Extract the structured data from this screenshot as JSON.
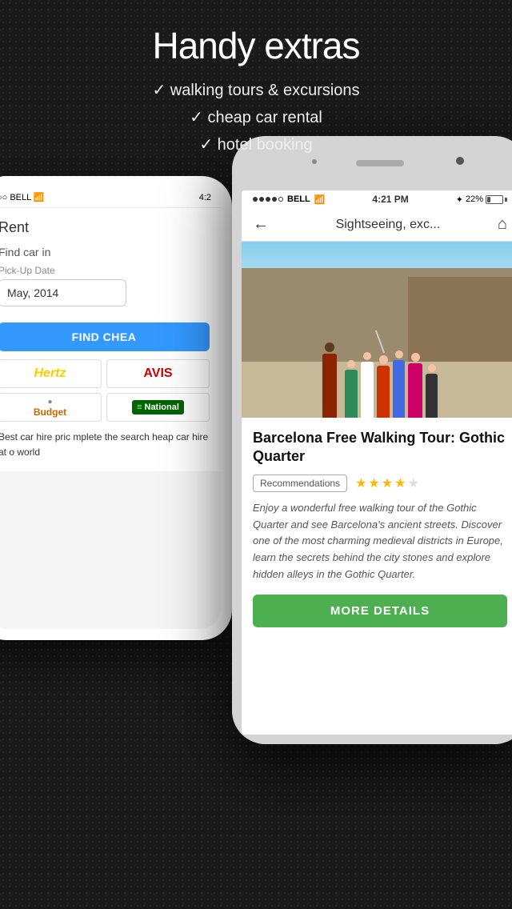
{
  "page": {
    "background_color": "#1a1a1a"
  },
  "header": {
    "title": "Handy extras",
    "features": [
      "✓ walking tours & excursions",
      "✓ cheap car rental",
      "✓ hotel booking"
    ]
  },
  "phone_back": {
    "status": {
      "carrier": "BELL",
      "time": "4:2",
      "wifi": true
    },
    "content": {
      "rent_label": "Rent",
      "find_car_label": "Find car in",
      "pickup_label": "Pick-Up Date",
      "date_value": "May, 2014",
      "find_button": "FIND CHEA",
      "logos": [
        {
          "name": "Hertz",
          "style": "hertz"
        },
        {
          "name": "AVIS",
          "style": "avis"
        },
        {
          "name": "Budget",
          "style": "budget"
        },
        {
          "name": "National",
          "style": "national"
        }
      ],
      "description": "Best car hire pric mplete the search heap car hire at o world"
    }
  },
  "phone_front": {
    "status": {
      "dots": [
        true,
        true,
        true,
        true,
        false
      ],
      "carrier": "BELL",
      "wifi": true,
      "time": "4:21 PM",
      "bluetooth": true,
      "battery": "22%"
    },
    "nav": {
      "back_icon": "←",
      "title": "Sightseeing, exc...",
      "home_icon": "⌂"
    },
    "tour": {
      "title": "Barcelona Free Walking Tour: Gothic Quarter",
      "tag": "Recommendations",
      "stars": 4,
      "max_stars": 5,
      "description": "Enjoy a wonderful free walking tour of the Gothic Quarter and see Barcelona's ancient streets. Discover one of the most charming medieval districts in Europe, learn the secrets behind the city stones and explore hidden alleys in the Gothic Quarter.",
      "button": "MORE DETAILS"
    }
  }
}
